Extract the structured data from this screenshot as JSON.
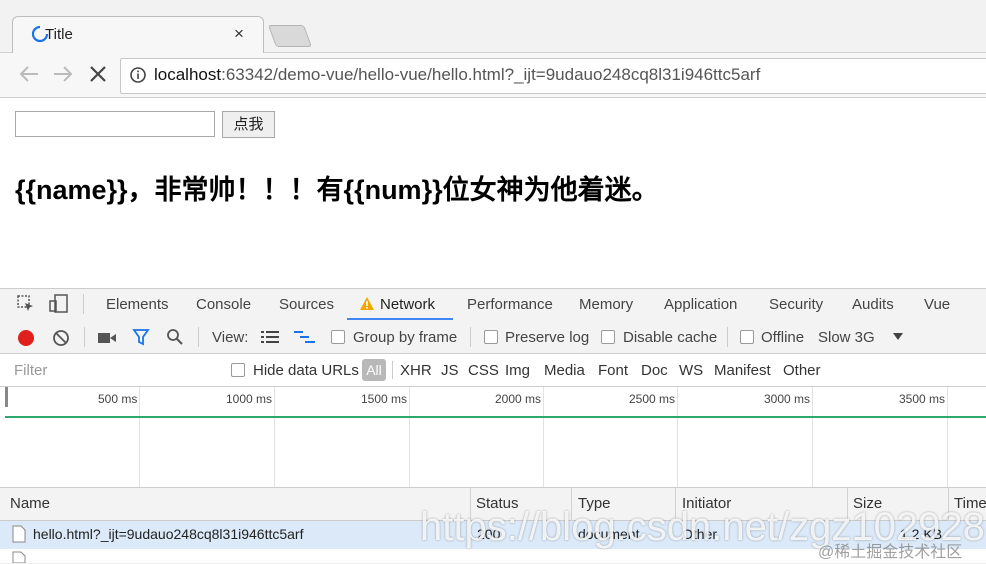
{
  "browser": {
    "tab_title": "Title",
    "tab_close": "×",
    "url_host": "localhost",
    "url_rest": ":63342/demo-vue/hello-vue/hello.html?_ijt=9udauo248cq8l31i946ttc5arf"
  },
  "page": {
    "button_label": "点我",
    "heading": "{{name}}，非常帅！！！有{{num}}位女神为他着迷。"
  },
  "devtools": {
    "tabs": [
      "Elements",
      "Console",
      "Sources",
      "Network",
      "Performance",
      "Memory",
      "Application",
      "Security",
      "Audits",
      "Vue"
    ],
    "active_tab": "Network",
    "toolbar": {
      "view_label": "View:",
      "group_by_frame": "Group by frame",
      "preserve_log": "Preserve log",
      "disable_cache": "Disable cache",
      "offline": "Offline",
      "throttle": "Slow 3G"
    },
    "filter": {
      "placeholder": "Filter",
      "hide_data_urls": "Hide data URLs",
      "types": [
        "All",
        "XHR",
        "JS",
        "CSS",
        "Img",
        "Media",
        "Font",
        "Doc",
        "WS",
        "Manifest",
        "Other"
      ]
    },
    "timeline_ticks": [
      "500 ms",
      "1000 ms",
      "1500 ms",
      "2000 ms",
      "2500 ms",
      "3000 ms",
      "3500 ms"
    ],
    "columns": [
      "Name",
      "Status",
      "Type",
      "Initiator",
      "Size",
      "Time"
    ],
    "rows": [
      {
        "name": "hello.html?_ijt=9udauo248cq8l31i946ttc5arf",
        "status": "200",
        "type": "document",
        "initiator": "Other",
        "size": "1.2 KB"
      }
    ]
  },
  "watermark": "https://blog.csdn.net/zgz102928",
  "watermark2": "@稀土掘金技术社区",
  "colors": {
    "record": "#e0201d",
    "accent": "#4285f4",
    "timeline": "#2ea86f",
    "filter_icon": "#1a73e8"
  }
}
